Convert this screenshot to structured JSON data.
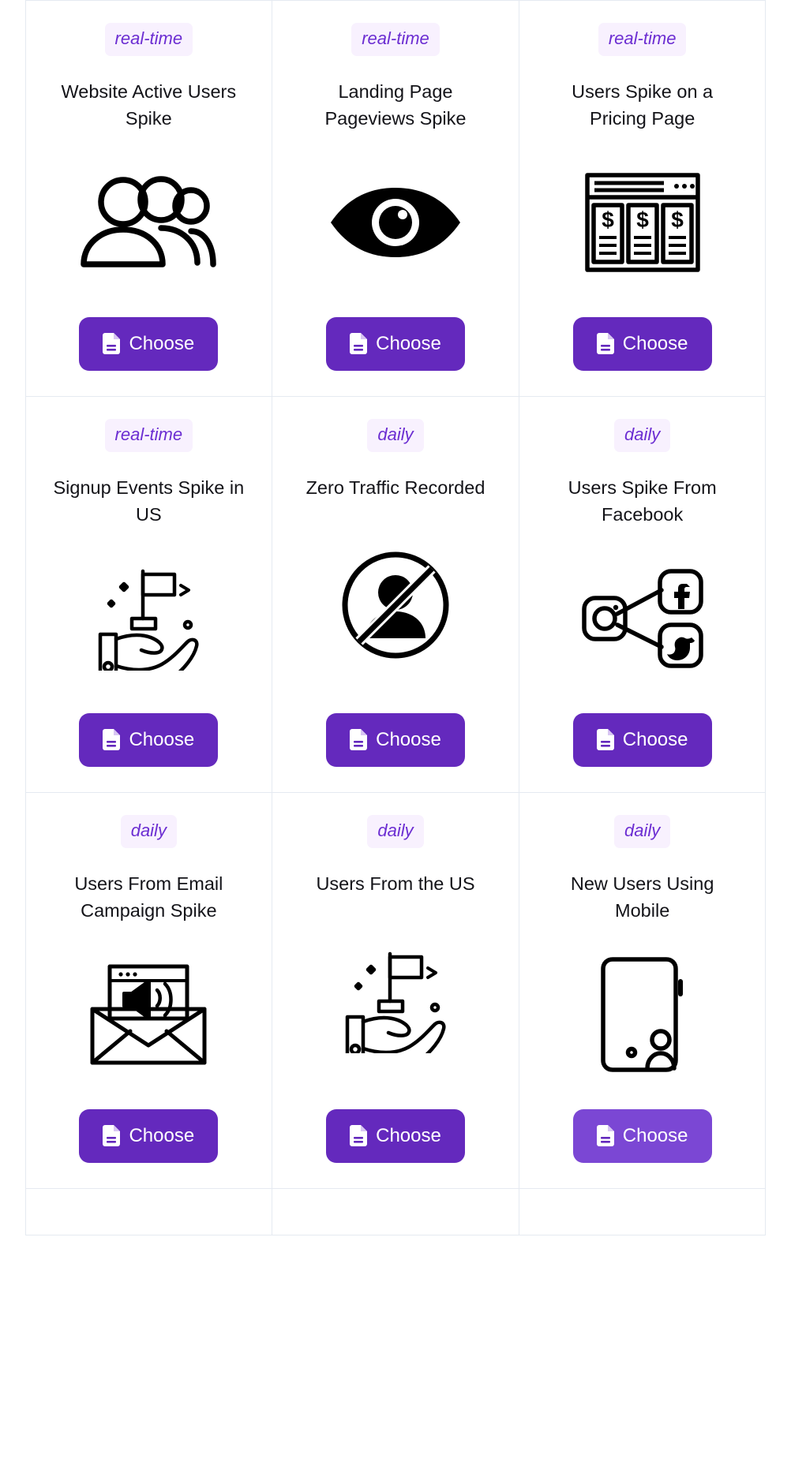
{
  "page": {
    "button_color": "#6429bd",
    "button_hover_color": "#7b47d4",
    "badge_bg_color": "#f8f1fe",
    "badge_text_color": "#6c2ed2",
    "card_border_color": "#e5eaf1"
  },
  "cards": [
    {
      "badge": "real-time",
      "title": "Website Active Users Spike",
      "icon": "people-group-icon",
      "button_label": "Choose",
      "button_state": "default"
    },
    {
      "badge": "real-time",
      "title": "Landing Page Pageviews Spike",
      "icon": "eye-icon",
      "button_label": "Choose",
      "button_state": "default"
    },
    {
      "badge": "real-time",
      "title": "Users Spike on a Pricing Page",
      "icon": "pricing-table-icon",
      "button_label": "Choose",
      "button_state": "default"
    },
    {
      "badge": "real-time",
      "title": "Signup Events Spike in US",
      "icon": "hand-flag-icon",
      "button_label": "Choose",
      "button_state": "default"
    },
    {
      "badge": "daily",
      "title": "Zero Traffic Recorded",
      "icon": "no-user-icon",
      "button_label": "Choose",
      "button_state": "default"
    },
    {
      "badge": "daily",
      "title": "Users Spike From Facebook",
      "icon": "social-share-icon",
      "button_label": "Choose",
      "button_state": "default"
    },
    {
      "badge": "daily",
      "title": "Users From Email Campaign Spike",
      "icon": "email-megaphone-icon",
      "button_label": "Choose",
      "button_state": "default"
    },
    {
      "badge": "daily",
      "title": "Users From the US",
      "icon": "hand-flag-icon",
      "button_label": "Choose",
      "button_state": "default"
    },
    {
      "badge": "daily",
      "title": "New Users Using Mobile",
      "icon": "mobile-user-icon",
      "button_label": "Choose",
      "button_state": "hovered"
    }
  ],
  "partial_row": {
    "visible": true
  }
}
